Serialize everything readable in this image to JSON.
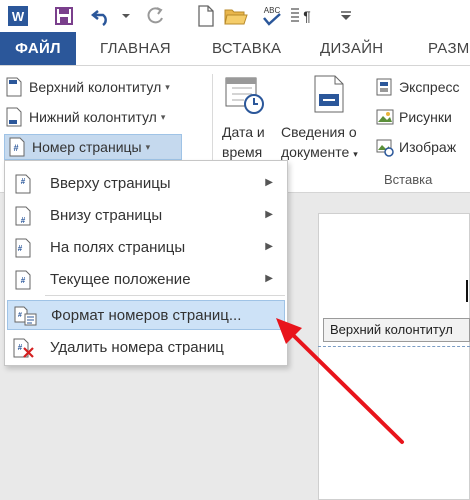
{
  "qat": {
    "icons": [
      "word-logo-icon",
      "save-icon",
      "undo-icon",
      "redo-icon",
      "new-document-icon",
      "open-folder-icon",
      "spelling-icon",
      "paragraph-marks-icon",
      "customize-qat-icon"
    ],
    "spelling_glyph": "ABC"
  },
  "tabs": [
    "ФАЙЛ",
    "ГЛАВНАЯ",
    "ВСТАВКА",
    "ДИЗАЙН",
    "РАЗМ"
  ],
  "ribbon": {
    "header_btn": "Верхний колонтитул",
    "footer_btn": "Нижний колонтитул",
    "page_number_btn": "Номер страницы",
    "date_time_line1": "Дата и",
    "date_time_line2": "время",
    "doc_info_line1": "Сведения о",
    "doc_info_line2": "документе",
    "express_btn": "Экспресс",
    "pictures_btn": "Рисунки",
    "images_btn": "Изображ",
    "group_label": "Вставка"
  },
  "menu": {
    "items": [
      {
        "label": "Вверху страницы",
        "submenu": true
      },
      {
        "label": "Внизу страницы",
        "submenu": true
      },
      {
        "label": "На полях страницы",
        "submenu": true
      },
      {
        "label": "Текущее положение",
        "submenu": true
      },
      {
        "label": "Формат номеров страниц...",
        "submenu": false
      },
      {
        "label": "Удалить номера страниц",
        "submenu": false
      }
    ]
  },
  "document": {
    "header_tooltip": "Верхний колонтитул"
  },
  "colors": {
    "file_tab": "#2b579a",
    "highlight": "#cde2f7",
    "arrow": "#e8141b"
  }
}
